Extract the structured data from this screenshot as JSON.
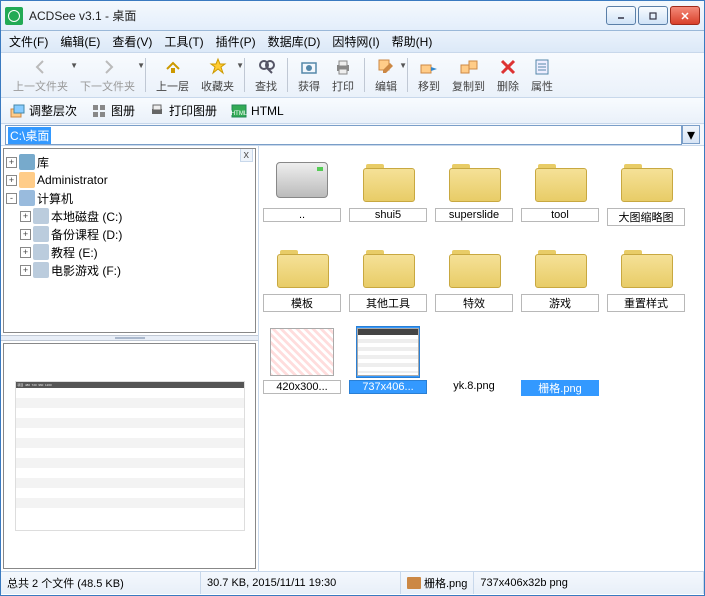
{
  "title": "ACDSee v3.1 - 桌面",
  "menu": [
    "文件(F)",
    "编辑(E)",
    "查看(V)",
    "工具(T)",
    "插件(P)",
    "数据库(D)",
    "因特网(I)",
    "帮助(H)"
  ],
  "toolbar": [
    {
      "label": "上一文件夹",
      "icon": "left",
      "disabled": true,
      "drop": true
    },
    {
      "label": "下一文件夹",
      "icon": "right",
      "disabled": true,
      "drop": true
    },
    {
      "sep": true
    },
    {
      "label": "上一层",
      "icon": "up"
    },
    {
      "label": "收藏夹",
      "icon": "fav",
      "drop": true
    },
    {
      "sep": true
    },
    {
      "label": "查找",
      "icon": "search"
    },
    {
      "sep": true
    },
    {
      "label": "获得",
      "icon": "acquire"
    },
    {
      "label": "打印",
      "icon": "print"
    },
    {
      "sep": true
    },
    {
      "label": "编辑",
      "icon": "edit",
      "drop": true
    },
    {
      "sep": true
    },
    {
      "label": "移到",
      "icon": "move"
    },
    {
      "label": "复制到",
      "icon": "copy"
    },
    {
      "label": "删除",
      "icon": "del"
    },
    {
      "label": "属性",
      "icon": "prop"
    }
  ],
  "toolbar2": [
    {
      "label": "调整层次",
      "icon": "layers"
    },
    {
      "label": "图册",
      "icon": "album"
    },
    {
      "label": "打印图册",
      "icon": "printalbum"
    },
    {
      "label": "HTML",
      "icon": "html"
    }
  ],
  "path": "C:\\桌面",
  "tree": [
    {
      "label": "库",
      "icon": "lib",
      "exp": "+",
      "lvl": 0
    },
    {
      "label": "Administrator",
      "icon": "user",
      "exp": "+",
      "lvl": 0
    },
    {
      "label": "计算机",
      "icon": "pc",
      "exp": "-",
      "lvl": 0
    },
    {
      "label": "本地磁盘 (C:)",
      "icon": "hdd",
      "exp": "+",
      "lvl": 1
    },
    {
      "label": "备份课程 (D:)",
      "icon": "hdd",
      "exp": "+",
      "lvl": 1
    },
    {
      "label": "教程 (E:)",
      "icon": "hdd",
      "exp": "+",
      "lvl": 1
    },
    {
      "label": "电影游戏 (F:)",
      "icon": "hdd",
      "exp": "+",
      "lvl": 1
    }
  ],
  "files_row1": [
    {
      "label": "..",
      "type": "hdd"
    },
    {
      "label": "shui5",
      "type": "folder"
    },
    {
      "label": "superslide",
      "type": "folder"
    },
    {
      "label": "tool",
      "type": "folder"
    },
    {
      "label": "大图缩略图",
      "type": "folder"
    }
  ],
  "files_row2": [
    {
      "label": "模板",
      "type": "folder"
    },
    {
      "label": "其他工具",
      "type": "folder"
    },
    {
      "label": "特效",
      "type": "folder"
    },
    {
      "label": "游戏",
      "type": "folder"
    },
    {
      "label": "重置样式",
      "type": "folder"
    }
  ],
  "files_row3": [
    {
      "label": "420x300...",
      "type": "img1"
    },
    {
      "label": "737x406...",
      "type": "img2",
      "selected": true
    },
    {
      "label": "yk.8.png",
      "type": "blank",
      "nolbl": true
    },
    {
      "label": "栅格.png",
      "type": "blank",
      "nolbl": true,
      "selbg": true
    }
  ],
  "status": {
    "s1": "总共 2 个文件 (48.5 KB)",
    "s2": "30.7 KB, 2015/11/11 19:30",
    "s3": "栅格.png",
    "s4": "737x406x32b png"
  }
}
